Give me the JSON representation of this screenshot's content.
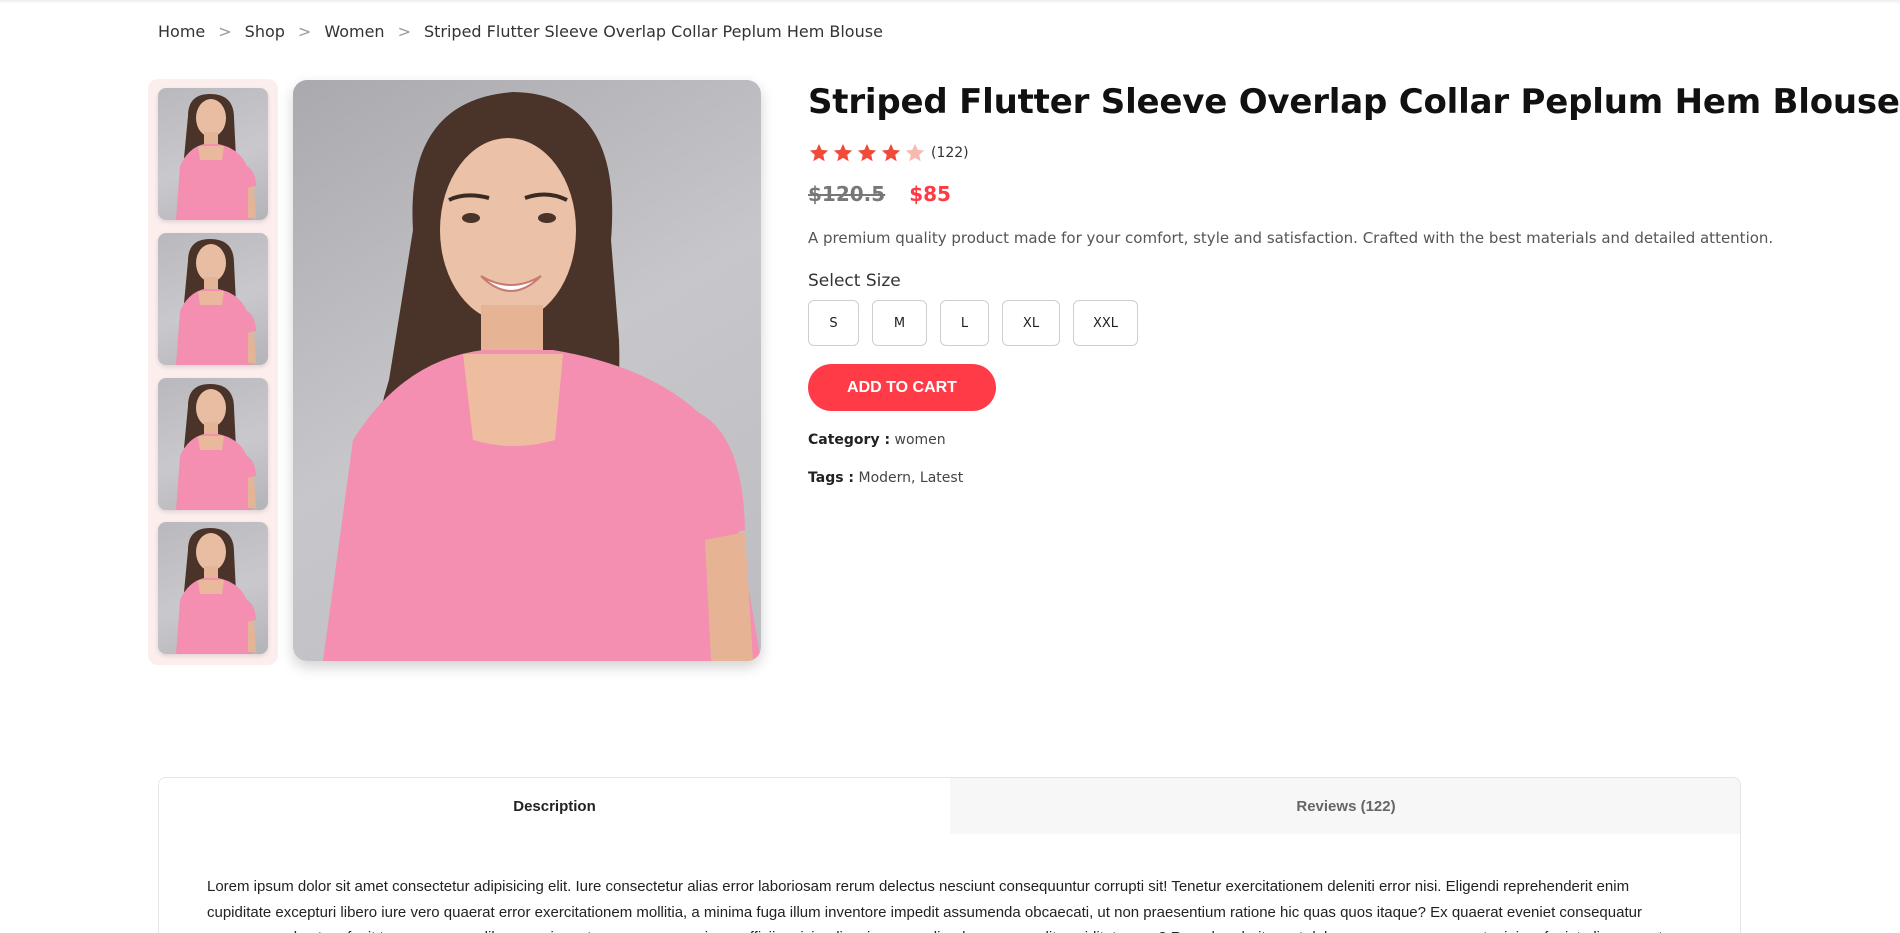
{
  "breadcrumb": {
    "items": [
      "Home",
      "Shop",
      "Women",
      "Striped Flutter Sleeve Overlap Collar Peplum Hem Blouse"
    ],
    "separator": ">"
  },
  "gallery": {
    "thumbnails": [
      {
        "icon": "product-thumbnail-woman-pink-top"
      },
      {
        "icon": "product-thumbnail-woman-pink-top"
      },
      {
        "icon": "product-thumbnail-woman-pink-top"
      },
      {
        "icon": "product-thumbnail-woman-pink-top"
      }
    ],
    "main_image_icon": "product-photo-woman-pink-top",
    "thumb_panel_color": "#fdeeee"
  },
  "product": {
    "title": "Striped Flutter Sleeve Overlap Collar Peplum Hem Blouse",
    "rating": {
      "value": 4,
      "max": 5,
      "count_label": "(122)"
    },
    "old_price": "$120.5",
    "price": "$85",
    "description": "A premium quality product made for your comfort, style and satisfaction. Crafted with the best materials and detailed attention.",
    "size_label": "Select Size",
    "sizes": [
      "S",
      "M",
      "L",
      "XL",
      "XXL"
    ],
    "add_to_cart": "ADD TO CART",
    "category_label": "Category :",
    "category_value": "women",
    "tags_label": "Tags :",
    "tags_value": "Modern, Latest"
  },
  "tabs": {
    "items": [
      {
        "label": "Description",
        "active": true
      },
      {
        "label": "Reviews (122)",
        "active": false
      }
    ],
    "description_text": "Lorem ipsum dolor sit amet consectetur adipisicing elit. Iure consectetur alias error laboriosam rerum delectus nesciunt consequuntur corrupti sit! Tenetur exercitationem deleniti error nisi. Eligendi reprehenderit enim cupiditate excepturi libero iure vero quaerat error exercitationem mollitia, a minima fuga illum inventore impedit assumenda obcaecati, ut non praesentium ratione hic quas quos itaque? Ex quaerat eveniet consequatur numquam vel autem fugit tempora neque libero, maiores tempore ea asperiores officiis reiciendis minus repudiandae eaque odit cupiditate vero? Reprehenderit amet dolorum numquam quaerat minima fugiat aliquam autem."
  },
  "colors": {
    "accent": "#ff3b48",
    "price_red": "#ff3a44",
    "star_filled": "#f04a3a",
    "star_empty": "#f8b9b0"
  }
}
